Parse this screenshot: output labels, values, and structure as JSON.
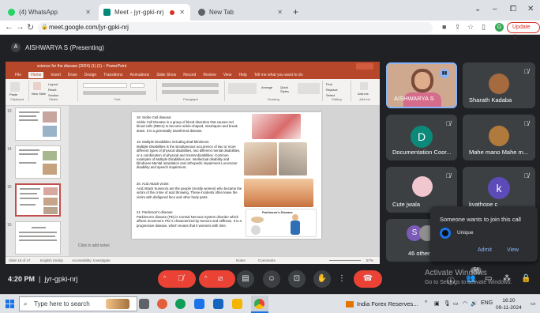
{
  "browser": {
    "tabs": [
      {
        "label": "(4) WhatsApp",
        "active": false
      },
      {
        "label": "Meet - jyr-gpki-nrj",
        "active": true
      },
      {
        "label": "New Tab",
        "active": false
      }
    ],
    "new_tab_glyph": "+",
    "window_controls": {
      "minimize": "⌄",
      "min": "–",
      "max": "⧠",
      "close": "✕"
    },
    "url": "meet.google.com/jyr-gpki-nrj",
    "profile_initial": "G",
    "update_label": "Update",
    "update_more": "⋮"
  },
  "presentation": {
    "presenter_label": "AISHWARYA S (Presenting)"
  },
  "powerpoint": {
    "title": "science for the disease (2024) (1) (1) – PowerPoint",
    "menu": [
      "File",
      "Home",
      "Insert",
      "Draw",
      "Design",
      "Transitions",
      "Animations",
      "Slide Show",
      "Record",
      "Review",
      "View",
      "Help",
      "Tell me what you want to do"
    ],
    "ribbon_groups": [
      "Clipboard",
      "Slides",
      "Font",
      "Paragraph",
      "Drawing",
      "Editing",
      "Add-ins"
    ],
    "ribbon_buttons": {
      "paste": "Paste",
      "new_slide": "New Slide",
      "layout": "Layout",
      "reset": "Reset",
      "section": "Section",
      "find": "Find",
      "replace": "Replace",
      "select": "Select",
      "addins": "Add-ins",
      "arrange": "Arrange",
      "quick_styles": "Quick Styles"
    },
    "thumb_numbers": [
      "13",
      "14",
      "15",
      "16"
    ],
    "slide_text": [
      "18. Sickle Cell disease:",
      "Sickle Cell Disease is a group of blood disorders that causes red blood cells (RBCs) to become sickle-shaped, misshapen and break down. It is a genetically transferred disease.",
      "19. Multiple Disabilities including deaf-blindness:",
      "Multiple Disabilities is the simultaneous occurrence of two or more different types of physical disabilities, two different mental disabilities, or a combination of physical and mental disabilities. Common examples of Multiple Disabilities are: Intellectual disability and blindness Mental retardation and orthopedic impairment Locomotor disability and speech impairment.",
      "20. Acid Attack victim:",
      "Acid Attack Survivors are the people (mostly women) who became the victim of the crime of acid throwing. These incidents often leave the victim with disfigured face and other body parts.",
      "21. Parkinson's disease:",
      "Parkinson's disease (PD) is Central Nervous System disorder which affects movement. PD is characterized by tremors and stiffness. It is a progressive disease, which means that it worsens with time."
    ],
    "image_label": "Parkinson's Disease",
    "notes_placeholder": "Click to add notes",
    "status": {
      "slide": "Slide 15 of 47",
      "language": "English (India)",
      "accessibility": "Accessibility: Investigate",
      "notes": "Notes",
      "comments": "Comments",
      "zoom": "57%"
    }
  },
  "participants": [
    {
      "name": "AISHWARYA S",
      "speaking": true
    },
    {
      "name": "Sharath Kadaba",
      "muted": true
    },
    {
      "name": "Documentation Coor...",
      "initial": "D",
      "avatar_color": "#0b8a7a",
      "muted": true
    },
    {
      "name": "Mahe mano Mahe m...",
      "muted": true
    },
    {
      "name": "Cute jwala",
      "muted": true
    },
    {
      "name": "kvathope c",
      "initial": "k",
      "avatar_color": "#5c4bb8",
      "muted": true
    },
    {
      "name": "46 others",
      "initial": "S",
      "avatar_color": "#7b5ab8"
    }
  ],
  "join_request": {
    "title": "Someone wants to join this call",
    "user": "Unique",
    "admit": "Admit",
    "view": "View"
  },
  "meeting": {
    "time": "4:20 PM",
    "separator": "|",
    "code": "jyr-gpki-nrj",
    "people_badge": "54",
    "controls": {
      "mic": "mic-off-icon",
      "camera": "camera-off-icon",
      "captions": "captions-icon",
      "emoji": "emoji-icon",
      "present": "present-icon",
      "hand": "raise-hand-icon",
      "more": "more-options-icon",
      "leave": "leave-call-icon"
    }
  },
  "watermark": {
    "line1": "Activate Windows",
    "line2": "Go to Settings to activate Windows."
  },
  "taskbar": {
    "search_placeholder": "Type here to search",
    "news": "India Forex Reserves...",
    "language": "ENG",
    "time": "16:20",
    "date": "09-11-2024"
  }
}
